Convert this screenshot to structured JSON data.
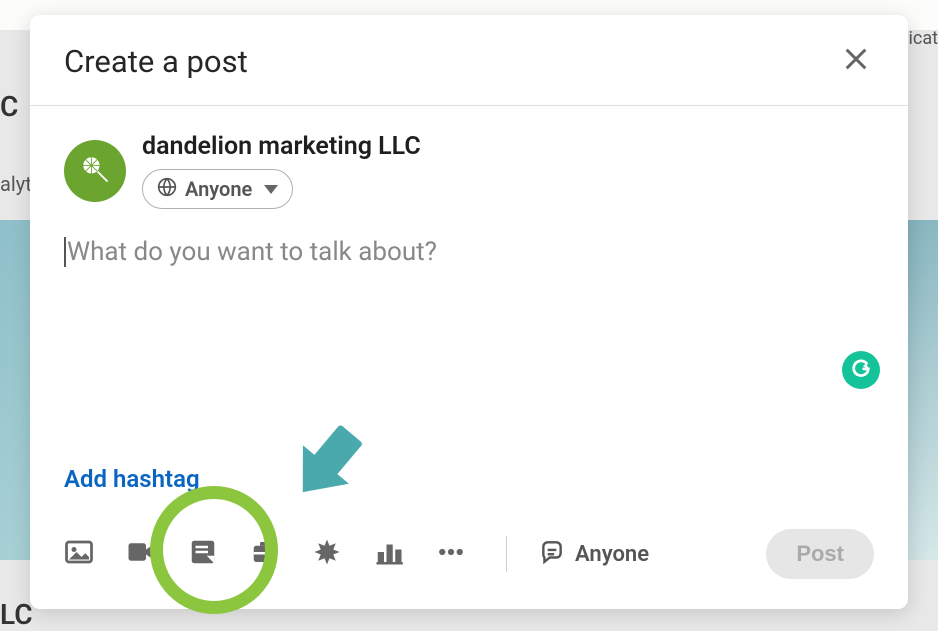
{
  "modal": {
    "title": "Create a post",
    "author_name": "dandelion marketing LLC",
    "audience_label": "Anyone",
    "composer_placeholder": "What do you want to talk about?",
    "add_hashtag_label": "Add hashtag",
    "footer_audience_label": "Anyone",
    "post_button_label": "Post"
  },
  "colors": {
    "accent_green": "#8cc63f",
    "arrow_teal": "#4aa9ad",
    "link_blue": "#0a66c2",
    "grammarly": "#15c39a"
  },
  "bg_fragments": {
    "t1": "C",
    "t2": "alyt",
    "t3": "LC",
    "t4": "icat"
  }
}
